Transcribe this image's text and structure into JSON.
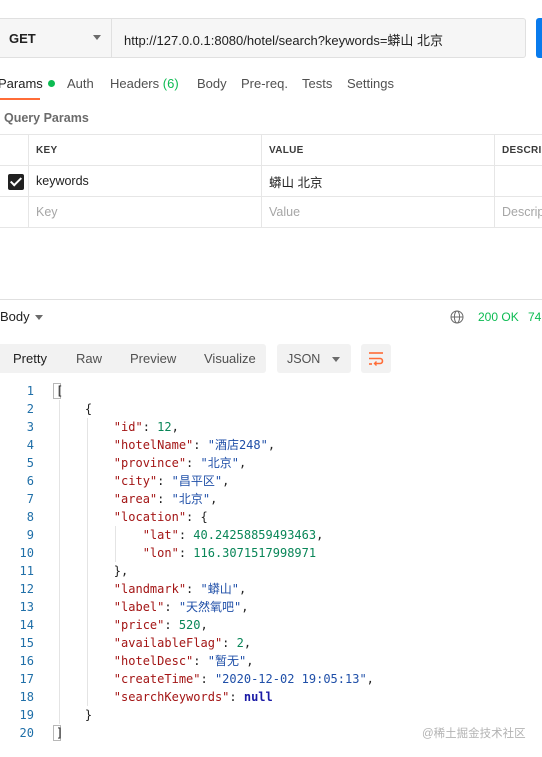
{
  "request": {
    "method": "GET",
    "url": "http://127.0.0.1:8080/hotel/search?keywords=蟒山 北京"
  },
  "tabs": [
    {
      "label": "Params",
      "active": true,
      "has_dot": true
    },
    {
      "label": "Auth"
    },
    {
      "label": "Headers",
      "count": "(6)"
    },
    {
      "label": "Body"
    },
    {
      "label": "Pre-req."
    },
    {
      "label": "Tests"
    },
    {
      "label": "Settings"
    }
  ],
  "query_params": {
    "title": "Query Params",
    "columns": [
      "KEY",
      "VALUE",
      "DESCRIPTION"
    ],
    "rows": [
      {
        "checked": true,
        "key": "keywords",
        "value": "蟒山 北京",
        "description": ""
      }
    ],
    "placeholder": {
      "key": "Key",
      "value": "Value",
      "description": "Description"
    }
  },
  "response": {
    "title": "Body",
    "status": "200 OK",
    "time": "74",
    "views": [
      "Pretty",
      "Raw",
      "Preview",
      "Visualize"
    ],
    "active_view": "Pretty",
    "format": "JSON",
    "line_numbers": [
      "1",
      "2",
      "3",
      "4",
      "5",
      "6",
      "7",
      "8",
      "9",
      "10",
      "11",
      "12",
      "13",
      "14",
      "15",
      "16",
      "17",
      "18",
      "19",
      "20"
    ]
  },
  "result": {
    "id": "12",
    "hotelName": "\"酒店248\"",
    "province": "\"北京\"",
    "city": "\"昌平区\"",
    "area": "\"北京\"",
    "lat": "40.24258859493463",
    "lon": "116.3071517998971",
    "landmark": "\"蟒山\"",
    "label": "\"天然氧吧\"",
    "price": "520",
    "availableFlag": "2",
    "hotelDesc": "\"暂无\"",
    "createTime": "\"2020-12-02 19:05:13\"",
    "searchKeywords": "null"
  },
  "watermark": "@稀土掘金技术社区",
  "colors": {
    "accent": "#ff6c37",
    "success": "#0cbb52",
    "send": "#097bed"
  }
}
